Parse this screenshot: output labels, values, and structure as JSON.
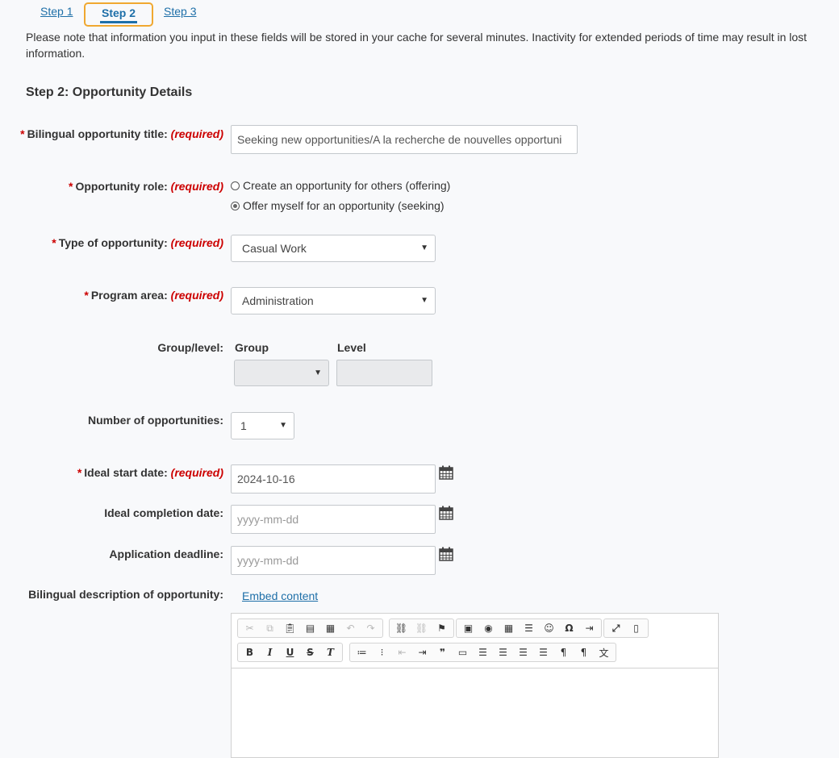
{
  "steps": {
    "step1": "Step 1",
    "step2": "Step 2",
    "step3": "Step 3"
  },
  "notice": "Please note that information you input in these fields will be stored in your cache for several minutes. Inactivity for extended periods of time may result in lost information.",
  "section_title": "Step 2: Opportunity Details",
  "required_marker": "(required)",
  "fields": {
    "title": {
      "label": "Bilingual opportunity title:",
      "value": "Seeking new opportunities/A la recherche de nouvelles opportuni"
    },
    "role": {
      "label": "Opportunity role:",
      "options": [
        {
          "label": "Create an opportunity for others (offering)",
          "selected": false
        },
        {
          "label": "Offer myself for an opportunity (seeking)",
          "selected": true
        }
      ]
    },
    "type": {
      "label": "Type of opportunity:",
      "value": "Casual Work"
    },
    "program_area": {
      "label": "Program area:",
      "value": "Administration"
    },
    "group_level": {
      "label": "Group/level:",
      "group_label": "Group",
      "level_label": "Level"
    },
    "count": {
      "label": "Number of opportunities:",
      "value": "1"
    },
    "start_date": {
      "label": "Ideal start date:",
      "value": "2024-10-16"
    },
    "completion_date": {
      "label": "Ideal completion date:",
      "placeholder": "yyyy-mm-dd"
    },
    "deadline": {
      "label": "Application deadline:",
      "placeholder": "yyyy-mm-dd"
    },
    "description": {
      "label": "Bilingual description of opportunity:",
      "embed_link": "Embed content"
    }
  },
  "icons": {
    "calendar": "calendar-icon",
    "dropdown": "chevron-down-icon"
  },
  "colors": {
    "link": "#1e6fa8",
    "required": "#cc0000",
    "current_step_border": "#f0a830"
  }
}
